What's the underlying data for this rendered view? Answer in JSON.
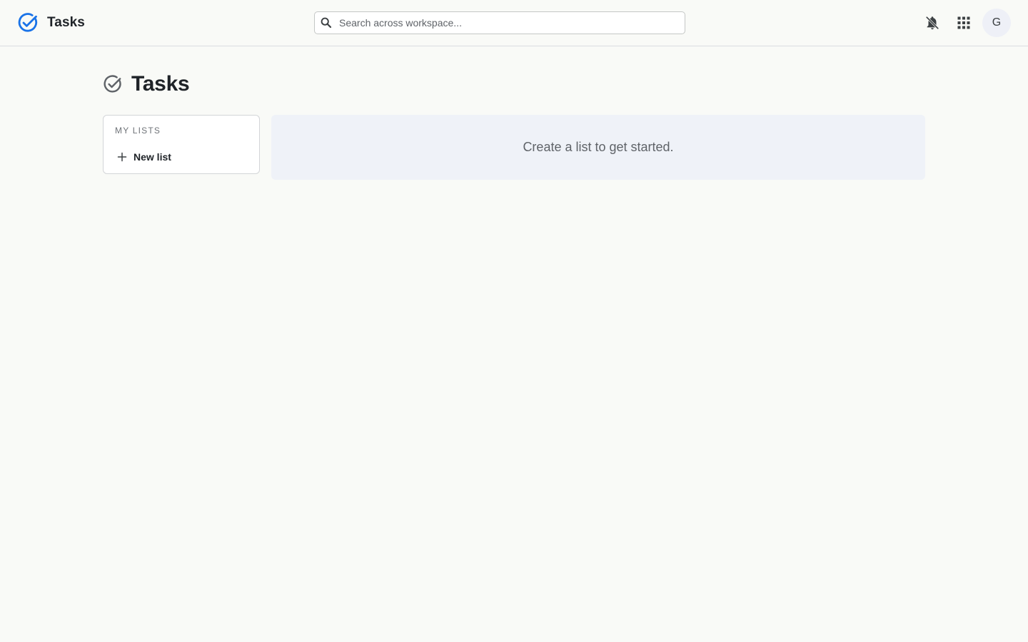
{
  "app": {
    "title": "Tasks",
    "accent_color": "#1a73e8"
  },
  "header": {
    "logo_icon": "check-circle-icon",
    "search": {
      "placeholder": "Search across workspace...",
      "value": "",
      "icon": "search-icon"
    },
    "notifications_icon": "notifications-off-icon",
    "apps_icon": "apps-grid-icon",
    "avatar_initial": "G"
  },
  "page": {
    "icon": "check-circle-icon",
    "title": "Tasks"
  },
  "sidebar": {
    "heading": "MY LISTS",
    "new_list_label": "New list",
    "new_list_icon": "plus-icon"
  },
  "main": {
    "empty_message": "Create a list to get started."
  }
}
